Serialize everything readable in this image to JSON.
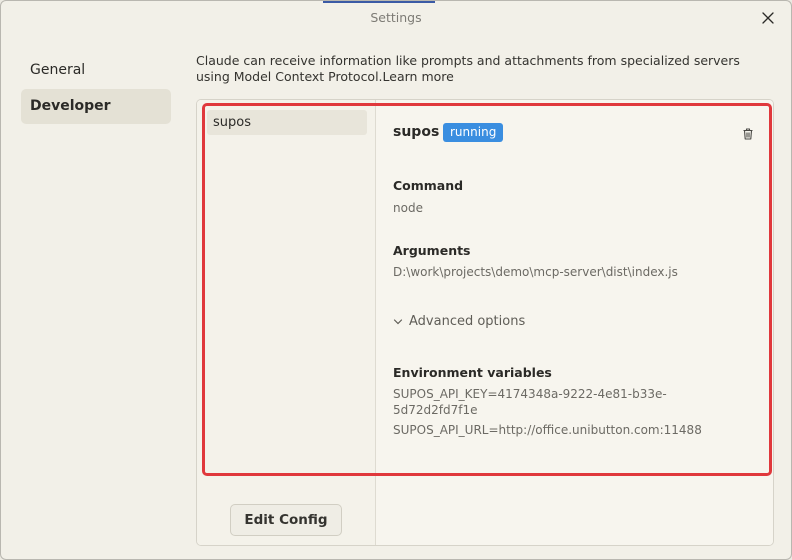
{
  "window": {
    "title": "Settings"
  },
  "sidebar": {
    "items": [
      {
        "label": "General"
      },
      {
        "label": "Developer"
      }
    ]
  },
  "intro": {
    "text": "Claude can receive information like prompts and attachments from specialized servers using Model Context Protocol.",
    "link": "Learn more"
  },
  "servers": {
    "list": [
      {
        "name": "supos"
      }
    ],
    "edit_config_label": "Edit Config"
  },
  "detail": {
    "name": "supos",
    "status": "running",
    "command_label": "Command",
    "command_value": "node",
    "arguments_label": "Arguments",
    "arguments_value": "D:\\work\\projects\\demo\\mcp-server\\dist\\index.js",
    "advanced_label": "Advanced options",
    "env_label": "Environment variables",
    "env_values": [
      "SUPOS_API_KEY=4174348a-9222-4e81-b33e-5d72d2fd7f1e",
      "SUPOS_API_URL=http://office.unibutton.com:11488"
    ]
  },
  "colors": {
    "badge": "#3a8ee0",
    "highlight": "#e0383c"
  },
  "icons": {
    "close": "close-icon",
    "trash": "trash-icon",
    "chevron": "chevron-down-icon"
  }
}
